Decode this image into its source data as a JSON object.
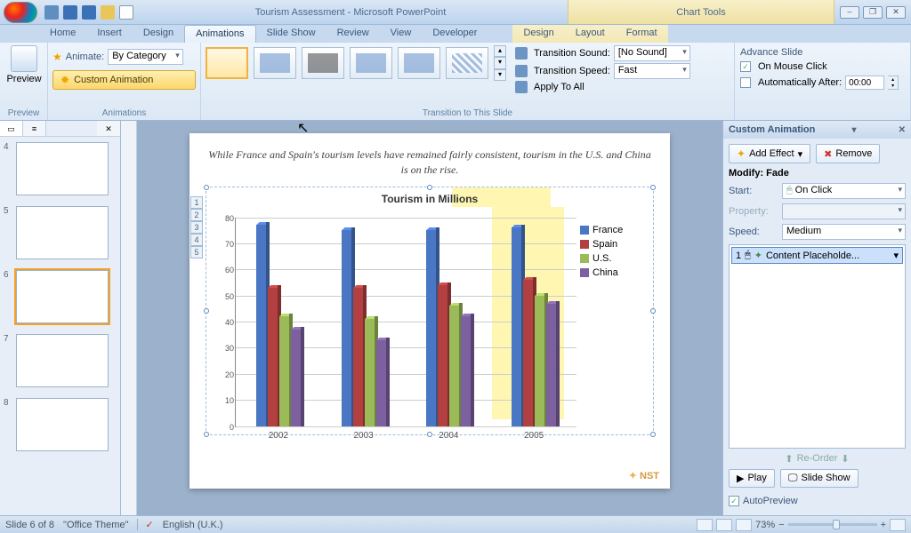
{
  "title": "Tourism Assessment - Microsoft PowerPoint",
  "context_label": "Chart Tools",
  "qat": [
    "save",
    "undo",
    "redo",
    "new",
    "open"
  ],
  "win_buttons": [
    "–",
    "❐",
    "✕"
  ],
  "tabs": [
    "Home",
    "Insert",
    "Design",
    "Animations",
    "Slide Show",
    "Review",
    "View",
    "Developer"
  ],
  "ctx_tabs": [
    "Design",
    "Layout",
    "Format"
  ],
  "active_tab": "Animations",
  "ribbon": {
    "preview_group": {
      "button": "Preview",
      "label": "Preview"
    },
    "animations_group": {
      "animate_label": "Animate:",
      "animate_value": "By Category",
      "custom_btn": "Custom Animation",
      "label": "Animations"
    },
    "transition_group": {
      "sound_label": "Transition Sound:",
      "sound_value": "[No Sound]",
      "speed_label": "Transition Speed:",
      "speed_value": "Fast",
      "apply_all": "Apply To All",
      "label": "Transition to This Slide"
    },
    "advance_group": {
      "title": "Advance Slide",
      "on_click": "On Mouse Click",
      "auto_after": "Automatically After:",
      "auto_value": "00:00"
    }
  },
  "slide_text": "While France and Spain's tourism levels have remained fairly consistent, tourism in the U.S. and China is on the rise.",
  "thumbnails": [
    {
      "n": "4"
    },
    {
      "n": "5"
    },
    {
      "n": "6",
      "sel": true,
      "star": true
    },
    {
      "n": "7"
    },
    {
      "n": "8"
    }
  ],
  "taskpane": {
    "title": "Custom Animation",
    "add_effect": "Add Effect",
    "remove": "Remove",
    "modify": "Modify: Fade",
    "start_label": "Start:",
    "start_value": "On Click",
    "property_label": "Property:",
    "speed_label": "Speed:",
    "speed_value": "Medium",
    "item_num": "1",
    "item_name": "Content Placeholde...",
    "reorder": "Re-Order",
    "play": "Play",
    "slideshow": "Slide Show",
    "autopreview": "AutoPreview"
  },
  "statusbar": {
    "slide": "Slide 6 of 8",
    "theme": "\"Office Theme\"",
    "lang": "English (U.K.)",
    "zoom": "73%"
  },
  "chart_data": {
    "type": "bar",
    "title": "Tourism in Millions",
    "categories": [
      "2002",
      "2003",
      "2004",
      "2005"
    ],
    "series": [
      {
        "name": "France",
        "color": "#4a77c4",
        "values": [
          77,
          75,
          75,
          76
        ]
      },
      {
        "name": "Spain",
        "color": "#b24040",
        "values": [
          53,
          53,
          54,
          56
        ]
      },
      {
        "name": "U.S.",
        "color": "#9bbb59",
        "values": [
          42,
          41,
          46,
          50
        ]
      },
      {
        "name": "China",
        "color": "#7d60a0",
        "values": [
          37,
          33,
          42,
          47
        ]
      }
    ],
    "ylim": [
      0,
      80
    ],
    "ystep": 10,
    "ylabel": "",
    "xlabel": ""
  }
}
